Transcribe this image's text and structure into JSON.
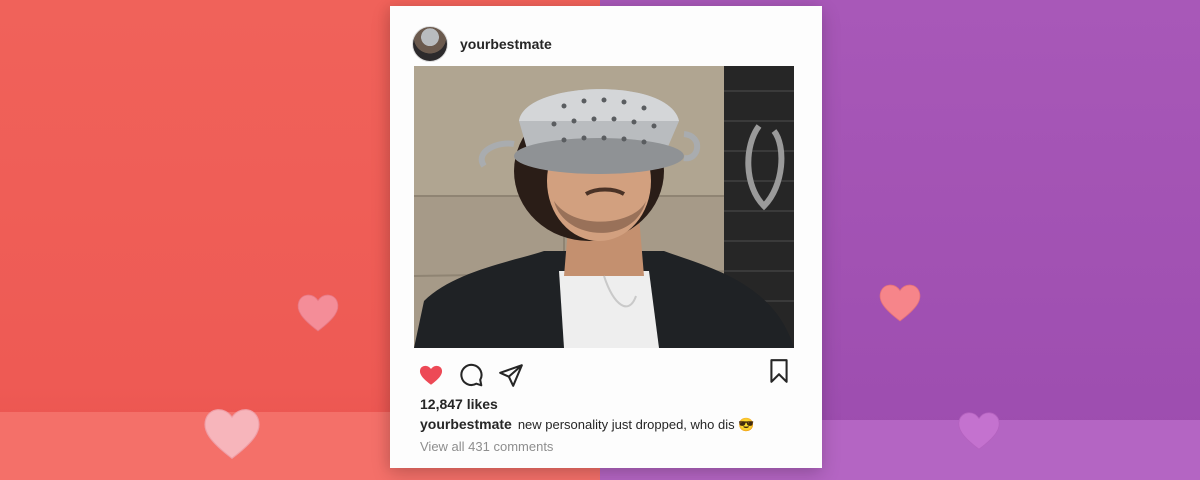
{
  "post": {
    "username": "yourbestmate",
    "likes": "12,847 likes",
    "caption_user": "yourbestmate",
    "caption_text": "new personality just dropped, who dis 😎",
    "view_comments": "View all 431 comments"
  },
  "icons": {
    "like": "heart-icon",
    "comment": "comment-icon",
    "share": "send-icon",
    "save": "bookmark-icon"
  },
  "colors": {
    "like_red": "#ed4956",
    "background_left": "#ee5a54",
    "background_right": "#a353b4"
  }
}
